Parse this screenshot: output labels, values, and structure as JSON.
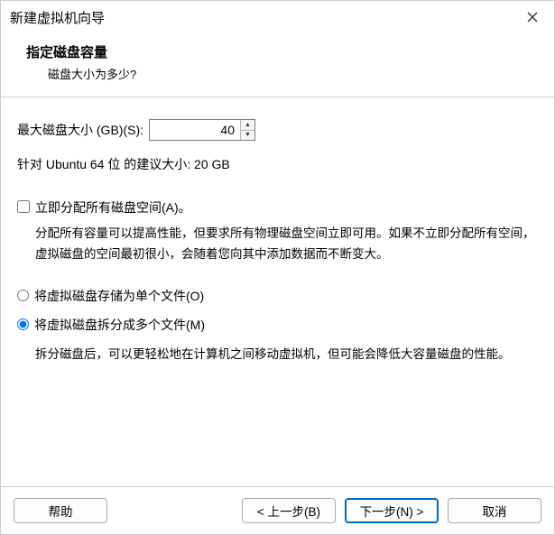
{
  "window": {
    "title": "新建虚拟机向导"
  },
  "header": {
    "title": "指定磁盘容量",
    "subtitle": "磁盘大小为多少?"
  },
  "disk": {
    "label": "最大磁盘大小 (GB)(S):",
    "value": "40",
    "recommended": "针对 Ubuntu 64 位 的建议大小: 20 GB"
  },
  "allocate": {
    "label": "立即分配所有磁盘空间(A)。",
    "desc": "分配所有容量可以提高性能，但要求所有物理磁盘空间立即可用。如果不立即分配所有空间，虚拟磁盘的空间最初很小，会随着您向其中添加数据而不断变大。"
  },
  "split": {
    "single_label": "将虚拟磁盘存储为单个文件(O)",
    "multi_label": "将虚拟磁盘拆分成多个文件(M)",
    "desc": "拆分磁盘后，可以更轻松地在计算机之间移动虚拟机，但可能会降低大容量磁盘的性能。"
  },
  "buttons": {
    "help": "帮助",
    "back": "< 上一步(B)",
    "next": "下一步(N) >",
    "cancel": "取消"
  }
}
